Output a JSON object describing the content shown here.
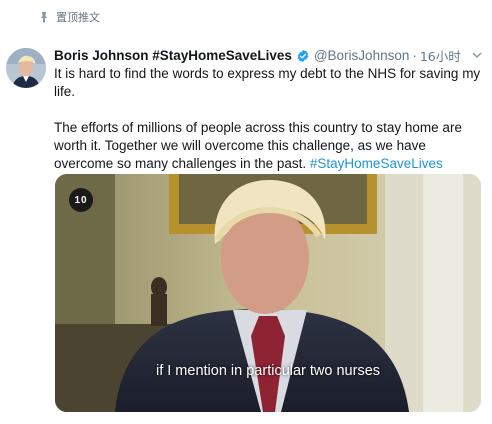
{
  "pinned": {
    "label": "置顶推文",
    "icon": "pin-icon"
  },
  "author": {
    "name": "Boris Johnson #StayHomeSaveLives",
    "handle": "@BorisJohnson",
    "separator": "·",
    "timestamp": "16小时",
    "verified": true
  },
  "tweet": {
    "paragraph1": "It is hard to find the words to express my debt to the NHS for saving my life.",
    "paragraph2_text": "The efforts of millions of people across this country to stay home are worth it. Together we will overcome this challenge, as we have overcome so many challenges in the past.",
    "hashtag": "#StayHomeSaveLives"
  },
  "media": {
    "channel_badge": "10",
    "caption": "if I mention in particular two nurses"
  },
  "colors": {
    "link": "#1b95e0",
    "verified": "#1da1f2",
    "muted": "#657786"
  }
}
